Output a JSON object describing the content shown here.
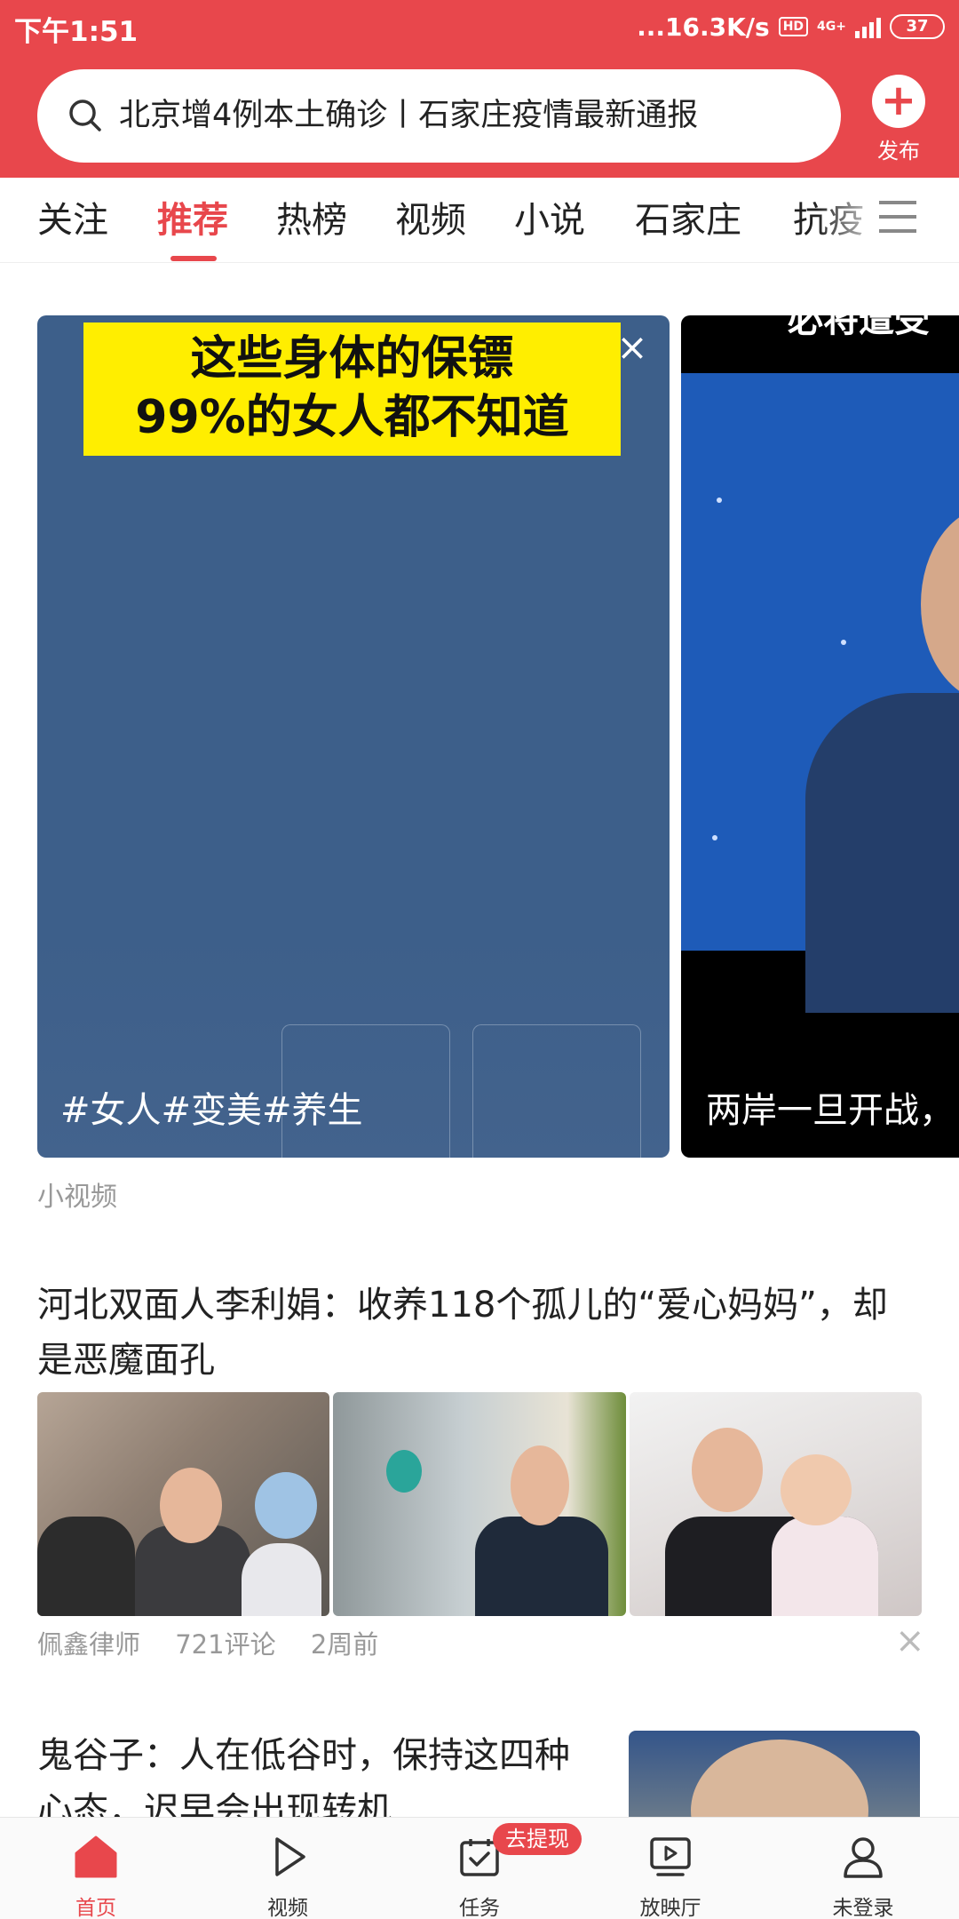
{
  "status_bar": {
    "time": "下午1:51",
    "net_speed": "...16.3K/s",
    "hd": "HD",
    "network": "4G+",
    "battery": "37"
  },
  "header": {
    "search_text": "北京增4例本土确诊丨石家庄疫情最新通报",
    "publish_label": "发布"
  },
  "tabs": [
    {
      "label": "关注"
    },
    {
      "label": "推荐",
      "active": true
    },
    {
      "label": "热榜"
    },
    {
      "label": "视频"
    },
    {
      "label": "小说"
    },
    {
      "label": "石家庄"
    },
    {
      "label": "抗疫"
    }
  ],
  "video_cards": [
    {
      "banner_line1": "这些身体的保镖",
      "banner_line2": "99%的女人都不知道",
      "caption": "#女人#变美#养生"
    },
    {
      "top_text": "必将遭受",
      "caption": "两岸一旦开战，"
    }
  ],
  "section_label": "小视频",
  "articles": [
    {
      "title": "河北双面人李利娟：收养118个孤儿的“爱心妈妈”，却是恶魔面孔",
      "author": "佩鑫律师",
      "comments": "721评论",
      "time": "2周前"
    },
    {
      "title": "鬼谷子：人在低谷时，保持这四种心态，迟早会出现转机"
    }
  ],
  "bottom_nav": [
    {
      "label": "首页",
      "icon": "home-icon",
      "active": true
    },
    {
      "label": "视频",
      "icon": "play-icon"
    },
    {
      "label": "任务",
      "icon": "task-icon"
    },
    {
      "label": "放映厅",
      "icon": "screening-icon"
    },
    {
      "label": "未登录",
      "icon": "user-icon"
    }
  ],
  "badge": {
    "withdraw": "去提现"
  },
  "colors": {
    "accent": "#e8474c"
  }
}
